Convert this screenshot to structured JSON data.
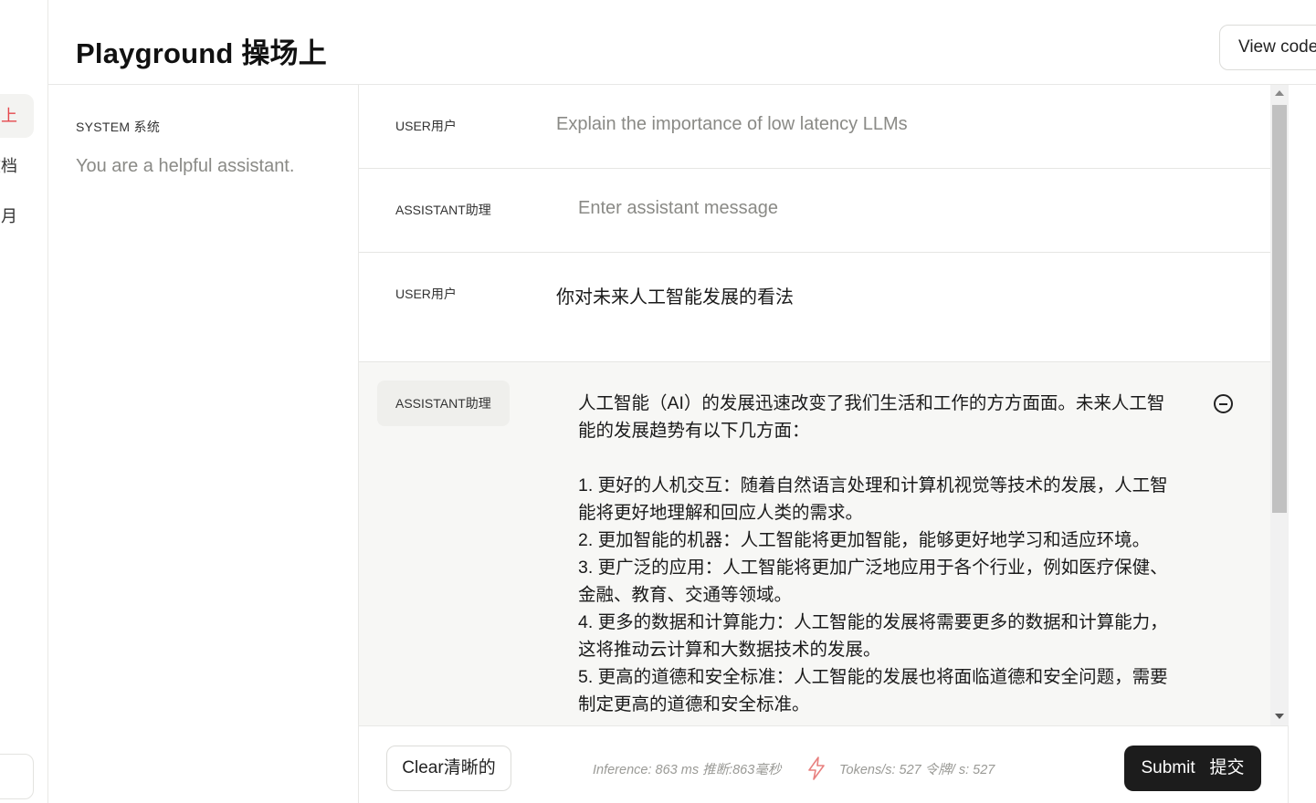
{
  "nav": {
    "items": [
      {
        "label": "上"
      },
      {
        "label": "文档"
      },
      {
        "label": "月"
      }
    ]
  },
  "header": {
    "title": "Playground 操场上",
    "view_code_label": "View code"
  },
  "system": {
    "label": "SYSTEM 系统",
    "text": "You are a helpful assistant."
  },
  "messages": [
    {
      "role": "USER用户",
      "text": "Explain the importance of low latency LLMs"
    },
    {
      "role": "ASSISTANT助理",
      "placeholder": "Enter assistant message"
    },
    {
      "role": "USER用户",
      "text": "你对未来人工智能发展的看法"
    },
    {
      "role": "ASSISTANT助理",
      "paragraphs": [
        "人工智能（AI）的发展迅速改变了我们生活和工作的方方面面。未来人工智能的发展趋势有以下几方面：",
        "",
        "1. 更好的人机交互：随着自然语言处理和计算机视觉等技术的发展，人工智能将更好地理解和回应人类的需求。",
        "2. 更加智能的机器：人工智能将更加智能，能够更好地学习和适应环境。",
        "3. 更广泛的应用：人工智能将更加广泛地应用于各个行业，例如医疗保健、金融、教育、交通等领域。",
        "4. 更多的数据和计算能力：人工智能的发展将需要更多的数据和计算能力，这将推动云计算和大数据技术的发展。",
        "5. 更高的道德和安全标准：人工智能的发展也将面临道德和安全问题，需要制定更高的道德和安全标准。"
      ]
    }
  ],
  "footer": {
    "clear_label": "Clear清晰的",
    "inference_stat": "Inference: 863 ms 推断:863毫秒",
    "tokens_stat": "Tokens/s: 527 令牌/ s: 527",
    "submit_label": "Submit   提交"
  },
  "colors": {
    "accent": "#e5484d",
    "submit_bg": "#1c1c1c",
    "bolt": "#e8807f"
  },
  "icons": [
    "remove-message-icon",
    "lightning-bolt-icon"
  ]
}
